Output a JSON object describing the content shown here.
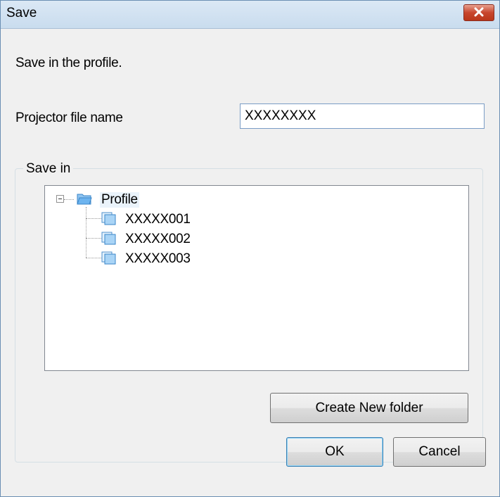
{
  "window": {
    "title": "Save"
  },
  "dialog": {
    "instruction": "Save in the profile.",
    "file_name_label": "Projector file name",
    "file_name_value": "XXXXXXXX",
    "save_in_label": "Save in"
  },
  "tree": {
    "root": {
      "label": "Profile",
      "expanded": true
    },
    "children": [
      {
        "label": "XXXXX001"
      },
      {
        "label": "XXXXX002"
      },
      {
        "label": "XXXXX003"
      }
    ]
  },
  "buttons": {
    "create_folder": "Create New folder",
    "ok": "OK",
    "cancel": "Cancel"
  },
  "colors": {
    "close_button": "#c8462d",
    "folder": "#6db4ef",
    "titlebar": "#dbe8f5"
  }
}
